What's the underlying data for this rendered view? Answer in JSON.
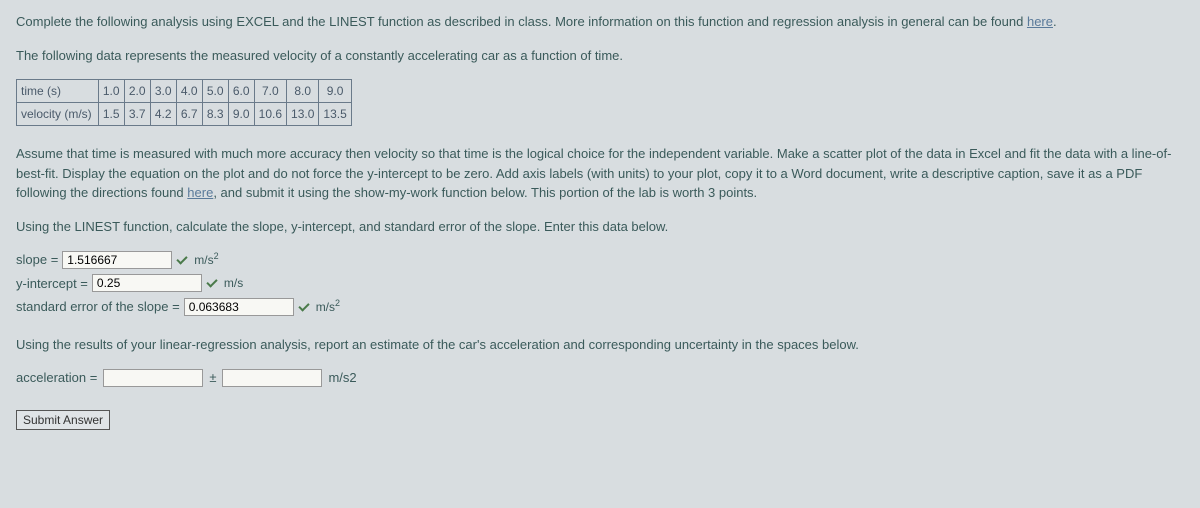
{
  "intro": {
    "p1_a": "Complete the following analysis using EXCEL and the LINEST function as described in class. More information on this function and regression analysis in general can be found ",
    "p1_link": "here",
    "p1_b": ".",
    "p2": "The following data represents the measured velocity of a constantly accelerating car as a function of time."
  },
  "table": {
    "row1_label": "time (s)",
    "row1": [
      "1.0",
      "2.0",
      "3.0",
      "4.0",
      "5.0",
      "6.0",
      "7.0",
      "8.0",
      "9.0"
    ],
    "row2_label": "velocity (m/s)",
    "row2": [
      "1.5",
      "3.7",
      "4.2",
      "6.7",
      "8.3",
      "9.0",
      "10.6",
      "13.0",
      "13.5"
    ]
  },
  "assume": {
    "a": "Assume that time is measured with much more accuracy then velocity so that time is the logical choice for the independent variable. Make a scatter plot of the data in Excel and fit the data with a line-of-best-fit. Display the equation on the plot and do not force the y-intercept to be zero. Add axis labels (with units) to your plot, copy it to a Word document, write a descriptive caption, save it as a PDF following the directions found ",
    "link": "here",
    "b": ", and submit it using the show-my-work function below. This portion of the lab is worth 3 points."
  },
  "linest_prompt": "Using the LINEST function, calculate the slope, y-intercept, and standard error of the slope. Enter this data below.",
  "inputs": {
    "slope_label": "slope = ",
    "slope_value": "1.516667",
    "slope_unit_base": "m/s",
    "slope_unit_sup": "2",
    "yint_label": "y-intercept = ",
    "yint_value": "0.25",
    "yint_unit": "m/s",
    "stderr_label": "standard error of the slope = ",
    "stderr_value": "0.063683",
    "stderr_unit_base": "m/s",
    "stderr_unit_sup": "2"
  },
  "accel_prompt": "Using the results of your linear-regression analysis, report an estimate of the car's acceleration and corresponding uncertainty in the spaces below.",
  "accel": {
    "label": "acceleration = ",
    "pm": "±",
    "unit_base": "m/s",
    "unit_sup": "2"
  },
  "submit_label": "Submit Answer"
}
